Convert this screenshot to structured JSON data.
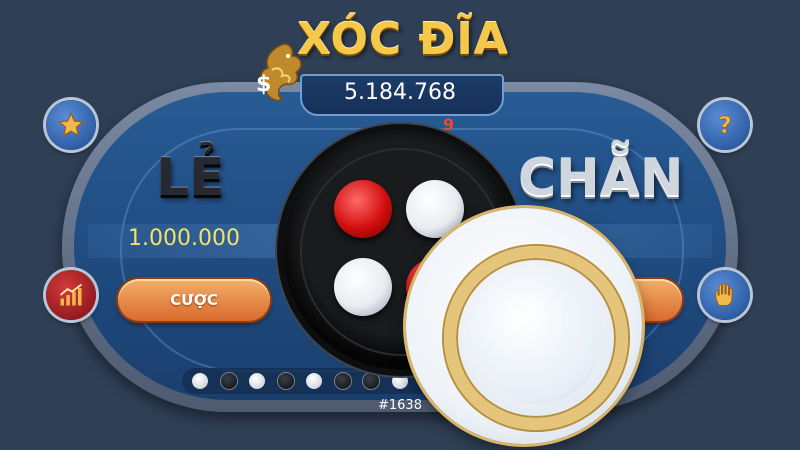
{
  "game": {
    "title": "XÓC ĐĨA",
    "currency_symbol": "$",
    "balance": "5.184.768",
    "countdown": "9",
    "left_side_label": "LẺ",
    "right_side_label": "CHẴN",
    "left_bet_amount": "1.000.000",
    "left_bet_button": "CƯỢC",
    "round_id": "#1638"
  },
  "buttons": {
    "top_left_icon": "star-icon",
    "top_right_icon": "help-icon",
    "bottom_left_icon": "chart-icon",
    "bottom_right_icon": "hand-icon"
  },
  "bowl_coins": [
    "red",
    "white",
    "white",
    "red"
  ],
  "history": [
    "white",
    "black",
    "white",
    "black",
    "white",
    "black",
    "black",
    "white"
  ],
  "colors": {
    "background": "#2f3f55",
    "table": "#285b95",
    "title_gold": "#f5c84a",
    "bet_amount": "#f3e26a",
    "countdown": "#e54c2e",
    "bet_button": "#e2823b"
  }
}
